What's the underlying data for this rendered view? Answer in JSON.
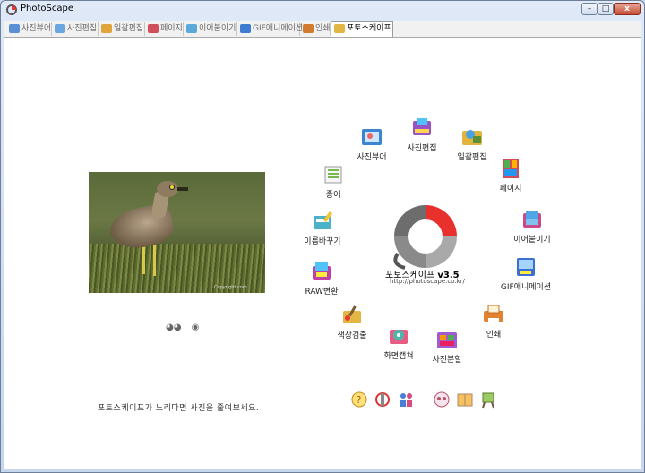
{
  "window": {
    "title": "PhotoScape",
    "minimize": "–",
    "maximize": "□",
    "close": "x"
  },
  "tabs": [
    {
      "label": "사진뷰어",
      "color": "#5a8fd3",
      "active": false
    },
    {
      "label": "사진편집",
      "color": "#6aa6e0",
      "active": false
    },
    {
      "label": "일괄편집",
      "color": "#e0a43a",
      "active": false
    },
    {
      "label": "페이지",
      "color": "#d04f5a",
      "active": false
    },
    {
      "label": "이어붙이기",
      "color": "#5aa9d8",
      "active": false
    },
    {
      "label": "GIF애니메이션",
      "color": "#3d7bd0",
      "active": false
    },
    {
      "label": "인쇄",
      "color": "#d27b2e",
      "active": false
    },
    {
      "label": "포토스케이프",
      "color": "#e3b542",
      "active": true
    }
  ],
  "main": {
    "logo_title": "포토스케이프",
    "logo_version": "v3.5",
    "logo_url": "http://photoscape.co.kr/",
    "photo_credit": "Copyright.com",
    "footer_message": "포토스케이프가 느리다면 사진을 줄여보세요.",
    "ring": [
      {
        "label": "사진뷰어",
        "icon": "photo-viewer-icon",
        "color": "#3a86d2"
      },
      {
        "label": "사진편집",
        "icon": "photo-editor-icon",
        "color": "#9a53c4"
      },
      {
        "label": "일괄편집",
        "icon": "batch-editor-icon",
        "color": "#e1b53b"
      },
      {
        "label": "페이지",
        "icon": "page-icon",
        "color": "#d44a58"
      },
      {
        "label": "이어붙이기",
        "icon": "combine-icon",
        "color": "#c94a86"
      },
      {
        "label": "GIF애니메이션",
        "icon": "gif-animation-icon",
        "color": "#3b6fd0"
      },
      {
        "label": "인쇄",
        "icon": "print-icon",
        "color": "#e0822f"
      },
      {
        "label": "사진분할",
        "icon": "splitter-icon",
        "color": "#a05bd1"
      },
      {
        "label": "화면캡쳐",
        "icon": "screen-capture-icon",
        "color": "#e65c83"
      },
      {
        "label": "색상검출",
        "icon": "color-picker-icon",
        "color": "#e3b542"
      },
      {
        "label": "RAW변환",
        "icon": "raw-converter-icon",
        "color": "#c040a8"
      },
      {
        "label": "이름바꾸기",
        "icon": "rename-icon",
        "color": "#4bb2c9"
      },
      {
        "label": "종이",
        "icon": "paper-print-icon",
        "color": "#78b84c"
      }
    ],
    "bottom_icons": [
      "help-icon",
      "tools-icon",
      "people-icon",
      "community-icon",
      "book-icon",
      "easel-icon"
    ]
  }
}
